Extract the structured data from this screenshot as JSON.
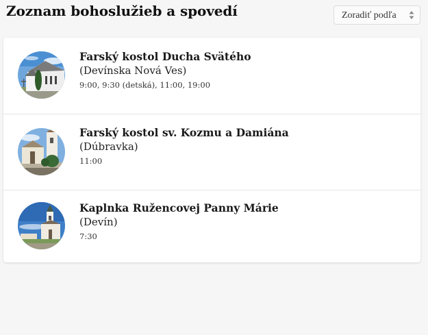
{
  "header": {
    "title": "Zoznam bohoslužieb a spovedí",
    "sort_label": "Zoradiť podľa"
  },
  "churches": [
    {
      "name": "Farský kostol Ducha Svätého",
      "place": "(Devínska Nová Ves)",
      "times": "9:00, 9:30 (detská), 11:00, 19:00",
      "image_icon": "church-photo"
    },
    {
      "name": "Farský kostol sv. Kozmu a Damiána",
      "place": "(Dúbravka)",
      "times": "11:00",
      "image_icon": "church-photo"
    },
    {
      "name": "Kaplnka Ružencovej Panny Márie",
      "place": "(Devín)",
      "times": "7:30",
      "image_icon": "chapel-photo"
    }
  ],
  "colors": {
    "page_background": "#f6f6f6",
    "card_background": "#ffffff",
    "divider": "#e5e5e5",
    "sky": "#6ea6dc"
  }
}
